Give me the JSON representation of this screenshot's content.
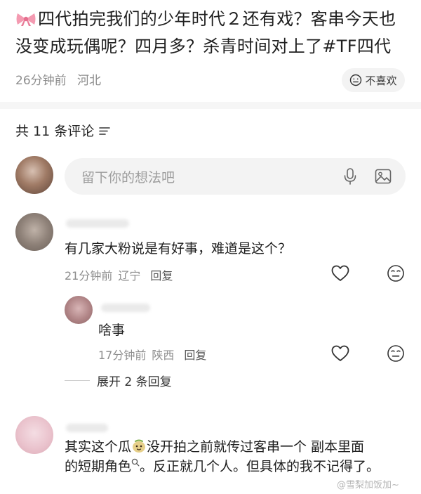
{
  "post": {
    "text": "四代拍完我们的少年时代２还有戏？客串今天也没变成玩偶呢？四月多？杀青时间对上了#TF四代",
    "time": "26分钟前",
    "location": "河北",
    "dislike_label": "不喜欢"
  },
  "comments_header": {
    "count_label": "共 11 条评论"
  },
  "comment_input": {
    "placeholder": "留下你的想法吧"
  },
  "comments": [
    {
      "text": "有几家大粉说是有好事，难道是这个？",
      "time": "21分钟前",
      "location": "辽宁",
      "reply_label": "回复"
    },
    {
      "text": "啥事",
      "time": "17分钟前",
      "location": "陕西",
      "reply_label": "回复"
    },
    {
      "text_a": "其实这个瓜",
      "text_b": "没开拍之前就传过客串一个 副本里面",
      "text_c": "的短期角色",
      "text_d": "。反正就几个人。但具体的我不记得了。"
    }
  ],
  "expand_replies": {
    "label": "展开 2 条回复"
  },
  "watermark": {
    "text": "@雪梨加饭加~"
  },
  "icons": {
    "bow": "ribbon-bow-icon",
    "dislike": "neutral-face-icon",
    "sort": "sort-lines-icon",
    "mic": "microphone-icon",
    "image": "image-icon",
    "heart": "heart-outline-icon",
    "meh": "meh-face-icon",
    "emoji": "melon-face-emoji-icon",
    "search": "search-icon"
  },
  "colors": {
    "text_primary": "#1f1f1f",
    "text_secondary": "#8d8d8d",
    "pill_bg": "#f3f3f3"
  }
}
